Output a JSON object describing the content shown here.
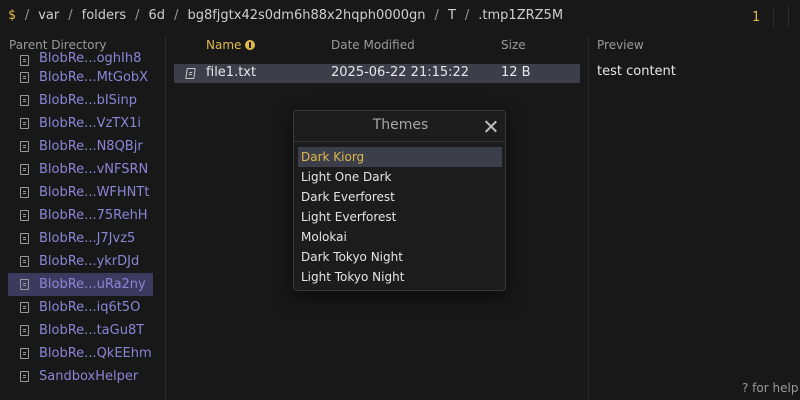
{
  "breadcrumb": {
    "root": "$",
    "segments": [
      "var",
      "folders",
      "6d",
      "bg8fjgtx42s0dm6h88x2hqph0000gn",
      "T",
      ".tmp1ZRZ5M"
    ]
  },
  "count_badge": "1",
  "parent_pane": {
    "title": "Parent Directory",
    "items": [
      "BlobRe...oghIh8",
      "BlobRe...MtGobX",
      "BlobRe...bISinp",
      "BlobRe...VzTX1i",
      "BlobRe...N8QBjr",
      "BlobRe...vNFSRN",
      "BlobRe...WFHNTt",
      "BlobRe...75RehH",
      "BlobRe...J7Jvz5",
      "BlobRe...ykrDJd",
      "BlobRe...uRa2ny",
      "BlobRe...iq6t5O",
      "BlobRe...taGu8T",
      "BlobRe...QkEEhm",
      "SandboxHelper"
    ],
    "selected_index": 10
  },
  "file_table": {
    "headers": {
      "name": "Name",
      "date": "Date Modified",
      "size": "Size"
    },
    "rows": [
      {
        "name": "file1.txt",
        "date": "2025-06-22 21:15:22",
        "size": "12 B"
      }
    ]
  },
  "preview": {
    "title": "Preview",
    "content": "test content"
  },
  "help_hint": "? for help",
  "themes_dialog": {
    "title": "Themes",
    "items": [
      "Dark Kiorg",
      "Light One Dark",
      "Dark Everforest",
      "Light Everforest",
      "Molokai",
      "Dark Tokyo Night",
      "Light Tokyo Night"
    ],
    "selected_index": 0
  },
  "colors": {
    "accent": "#e0b94a",
    "link": "#8b85d6",
    "background": "#181818",
    "selection": "#3c3f4a"
  }
}
